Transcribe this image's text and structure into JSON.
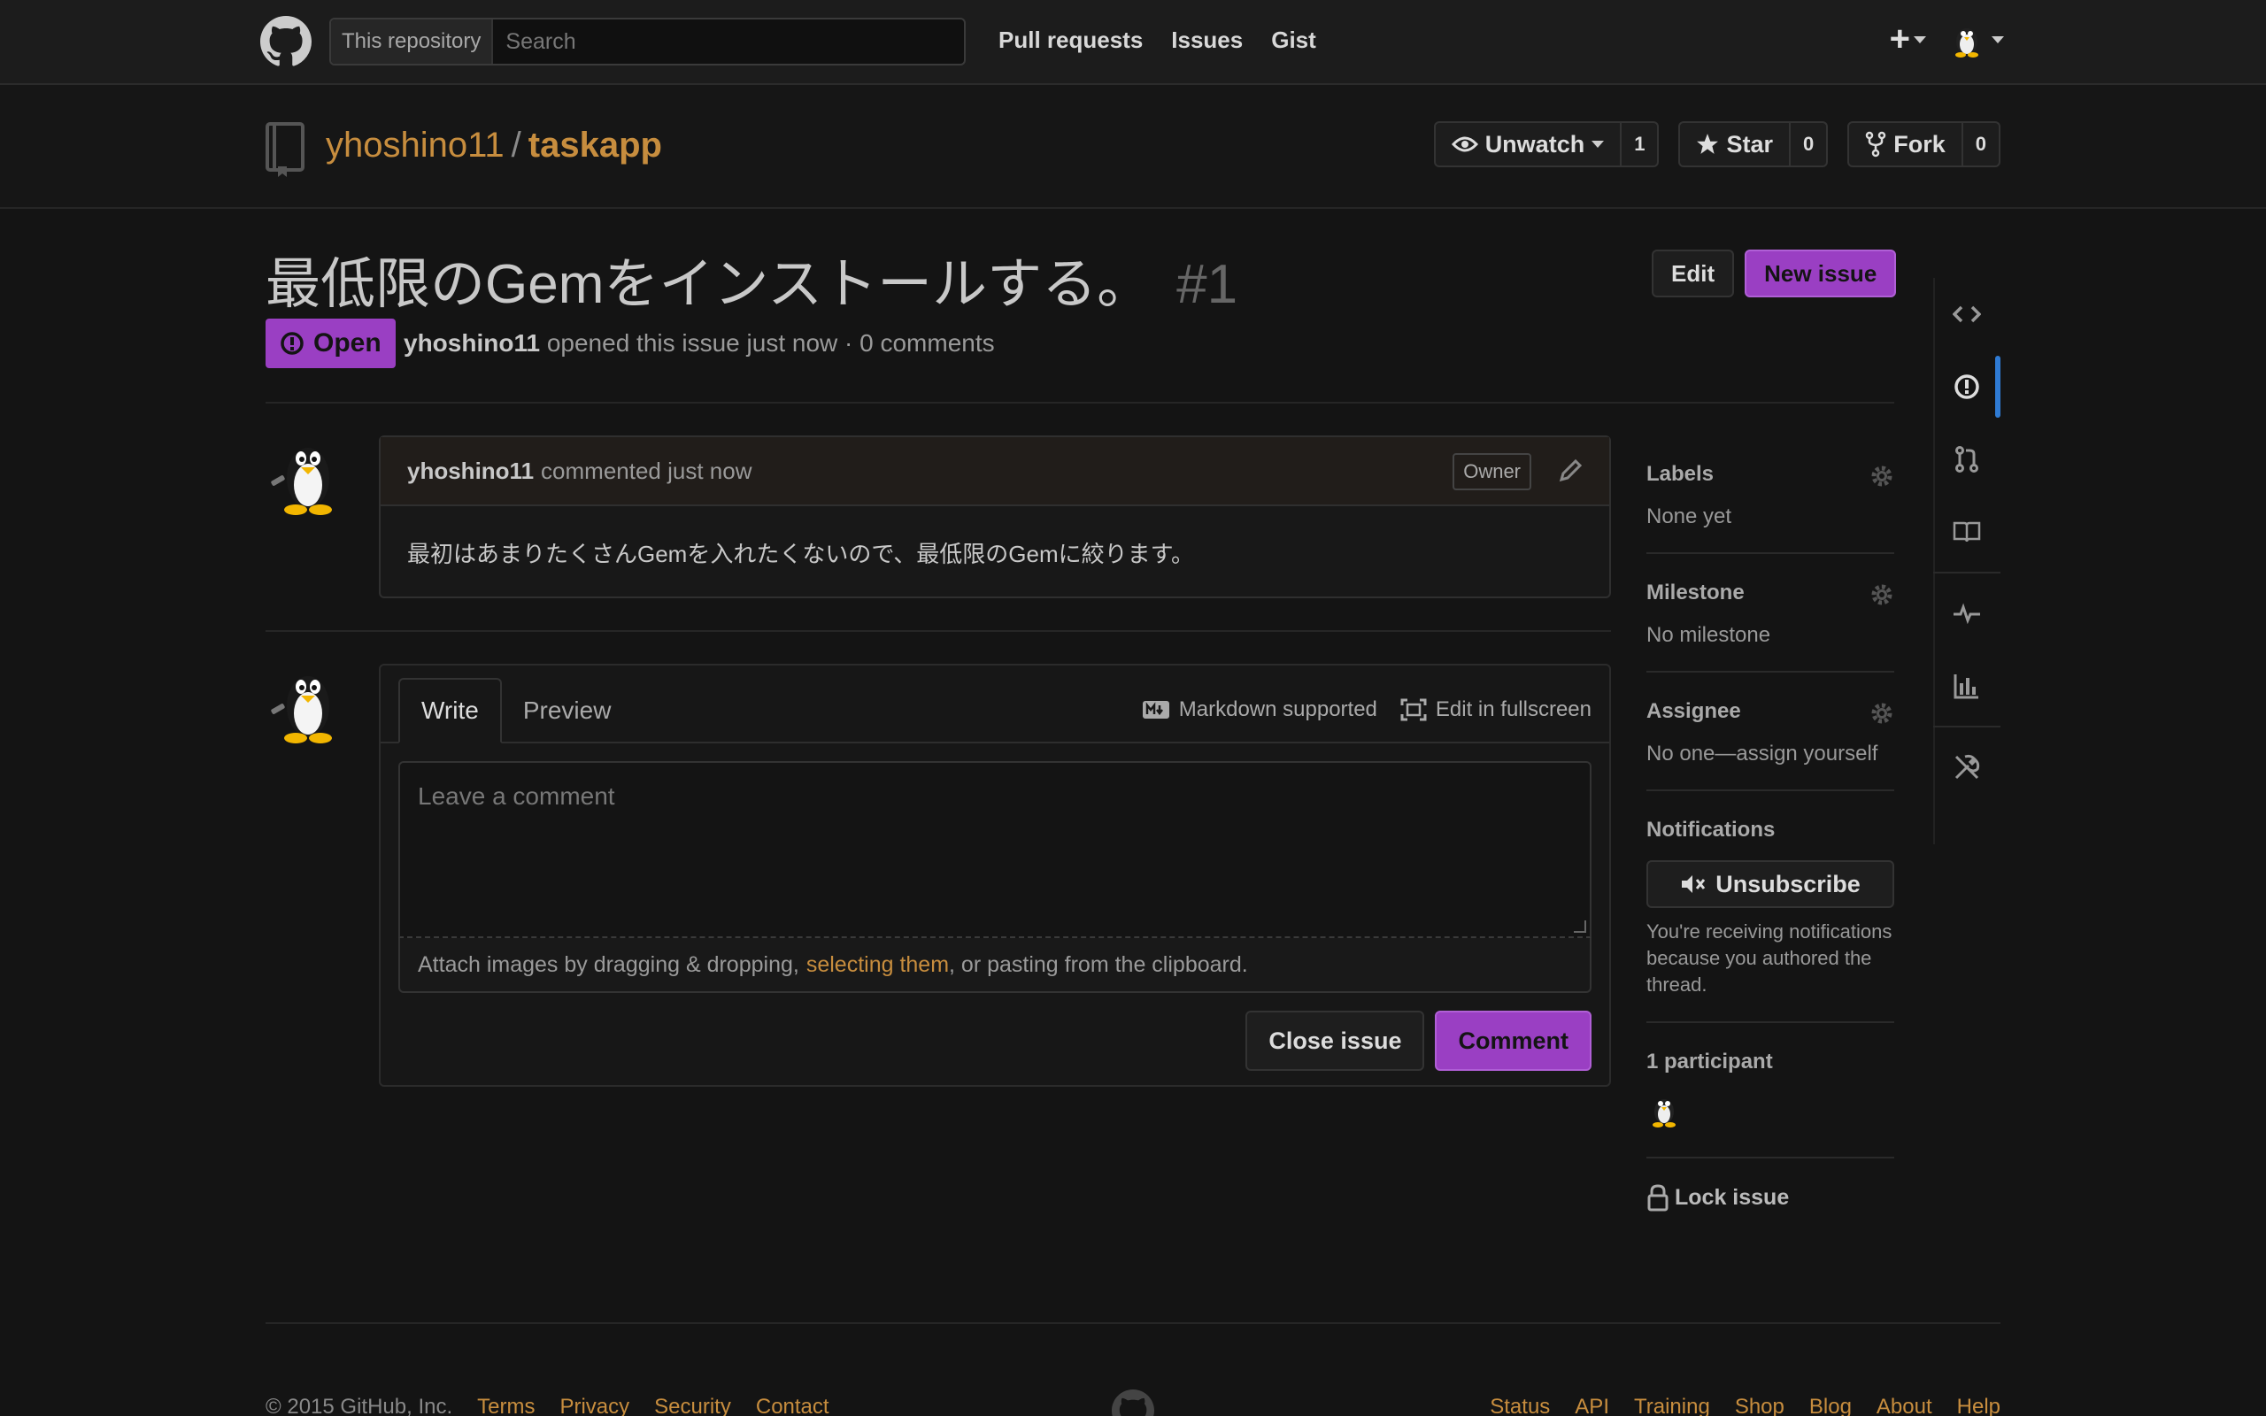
{
  "header": {
    "search_scope": "This repository",
    "search_placeholder": "Search",
    "nav": [
      "Pull requests",
      "Issues",
      "Gist"
    ],
    "plus_label": "+"
  },
  "repo": {
    "owner": "yhoshino11",
    "separator": "/",
    "name": "taskapp",
    "watch_label": "Unwatch",
    "watch_count": "1",
    "star_label": "Star",
    "star_count": "0",
    "fork_label": "Fork",
    "fork_count": "0"
  },
  "issue": {
    "title": "最低限のGemをインストールする。",
    "number": "#1",
    "edit_label": "Edit",
    "new_issue_label": "New issue",
    "state": "Open",
    "author": "yhoshino11",
    "meta_text": "opened this issue just now · 0 comments"
  },
  "comment": {
    "author": "yhoshino11",
    "action": "commented just now",
    "badge": "Owner",
    "body": "最初はあまりたくさんGemを入れたくないので、最低限のGemに絞ります。"
  },
  "form": {
    "tab_write": "Write",
    "tab_preview": "Preview",
    "markdown_label": "Markdown supported",
    "fullscreen_label": "Edit in fullscreen",
    "placeholder": "Leave a comment",
    "attach_before": "Attach images by dragging & dropping,",
    "attach_link": "selecting them",
    "attach_after": ", or pasting from the clipboard.",
    "close_label": "Close issue",
    "comment_label": "Comment"
  },
  "sidebar": {
    "labels_title": "Labels",
    "labels_value": "None yet",
    "milestone_title": "Milestone",
    "milestone_value": "No milestone",
    "assignee_title": "Assignee",
    "assignee_value": "No one—assign yourself",
    "notifications_title": "Notifications",
    "unsubscribe_label": "Unsubscribe",
    "notifications_text": "You're receiving notifications because you authored the thread.",
    "participants_title": "1 participant",
    "lock_label": "Lock issue"
  },
  "footer": {
    "copyright": "© 2015 GitHub, Inc.",
    "left_links": [
      "Terms",
      "Privacy",
      "Security",
      "Contact"
    ],
    "right_links": [
      "Status",
      "API",
      "Training",
      "Shop",
      "Blog",
      "About",
      "Help"
    ]
  },
  "colors": {
    "accent_purple": "#9a3fc3",
    "link_orange": "#c78d3e",
    "active_rail_blue": "#2f7bd4",
    "background": "#141414"
  }
}
